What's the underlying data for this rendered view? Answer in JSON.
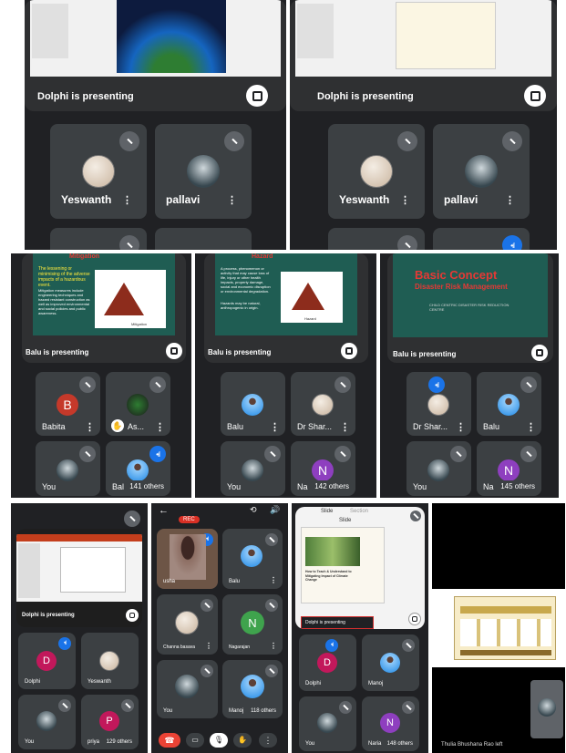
{
  "s1": {
    "presenter": "Dolphi is presenting",
    "t1": "Yeswanth",
    "t2": "pallavi"
  },
  "s2": {
    "presenter": "Dolphi is presenting",
    "t1": "Yeswanth",
    "t2": "pallavi"
  },
  "s3": {
    "presenter": "Balu is presenting",
    "slide_title": "Mitigation",
    "slide_text": "The lessening or minimising of the adverse impacts of a hazardous event.",
    "slide_text2": "Mitigation measures include engineering techniques and hazard resistant construction as well as improved environmental and social policies and public awareness.",
    "caption": "Mitigation",
    "t1_initial": "B",
    "t1": "Babita",
    "t2": "As...",
    "t3": "You",
    "t4": "Bal",
    "others": "141 others"
  },
  "s4": {
    "presenter": "Balu is presenting",
    "slide_title": "Hazard",
    "slide_text": "A process, phenomenon or activity that may cause loss of life, injury or other health impacts, property damage, social and economic disruption or environmental degradation.",
    "slide_text2": "Hazards may be natural, anthropogenic in origin.",
    "caption": "Hazard",
    "t1": "Balu",
    "t2": "Dr Shar...",
    "t3": "You",
    "t4_initial": "N",
    "t4": "Na",
    "others": "142 others"
  },
  "s5": {
    "presenter": "Balu is presenting",
    "slide_title": "Basic Concept",
    "slide_subtitle": "Disaster Risk Management",
    "slide_text": "CHILD CENTRIC DISASTER RISK REDUCTION CENTRE",
    "t1": "Dr Shar...",
    "t2": "Balu",
    "t3": "You",
    "t4_initial": "N",
    "t4": "Na",
    "others": "145 others"
  },
  "s6": {
    "presenter": "Dolphi is presenting",
    "t1_initial": "D",
    "t1": "Dolphi",
    "t2": "Yeswanth",
    "t3": "You",
    "t4_initial": "P",
    "t4": "priya",
    "others": "129 others"
  },
  "s7": {
    "rec": "REC",
    "t1": "usha",
    "t2": "Balu",
    "t3": "Channa basava",
    "t4_initial": "N",
    "t4": "Nagarajan",
    "t5": "You",
    "t6": "Manoj",
    "others": "118 others"
  },
  "s8": {
    "tab1": "Slide",
    "tab2": "Section",
    "tab3": "Slide",
    "slide_text": "How to Teach & Understand to Mitigating Impact of Climate Change",
    "presenter": "Dolphi is presenting",
    "t1_initial": "D",
    "t1": "Dolphi",
    "t2": "Manoj",
    "t3": "You",
    "t4_initial": "N",
    "t4": "Naria",
    "others": "148 others"
  },
  "s9": {
    "footer": "Thulia Bhushana Rao left"
  }
}
